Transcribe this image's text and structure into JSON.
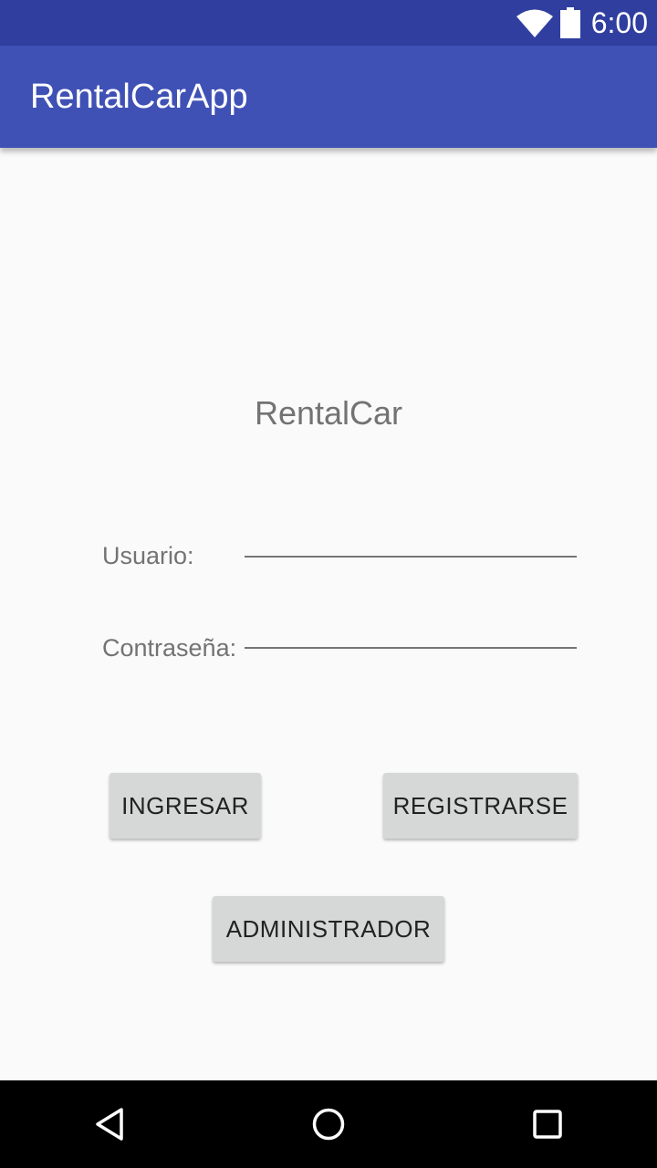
{
  "status_bar": {
    "time": "6:00",
    "icons": [
      "wifi-icon",
      "battery-icon"
    ]
  },
  "app_bar": {
    "title": "RentalCarApp"
  },
  "login": {
    "heading": "RentalCar",
    "user_label": "Usuario:",
    "user_value": "",
    "password_label": "Contraseña:",
    "password_value": ""
  },
  "buttons": {
    "ingresar": "INGRESAR",
    "registrarse": "REGISTRARSE",
    "administrador": "ADMINISTRADOR"
  },
  "nav_bar": {
    "icons": [
      "back-icon",
      "home-icon",
      "recents-icon"
    ]
  },
  "colors": {
    "status_bar": "#303f9f",
    "app_bar": "#3f51b5",
    "background": "#fafafa",
    "button": "#d6d7d7",
    "nav_bar": "#000000"
  }
}
